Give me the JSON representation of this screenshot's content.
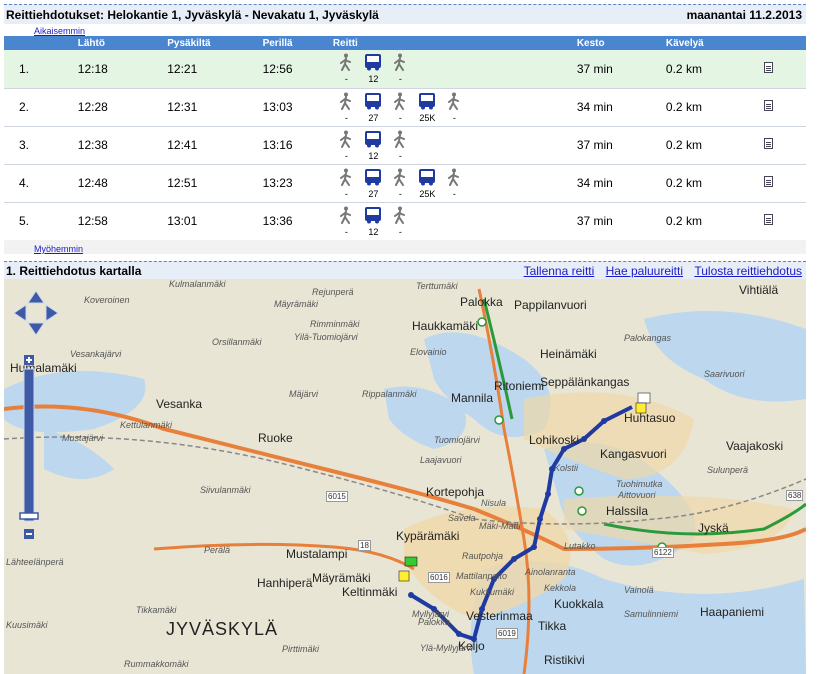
{
  "header": {
    "title": "Reittiehdotukset: Helokantie 1, Jyväskylä - Nevakatu 1, Jyväskylä",
    "date": "maanantai 11.2.2013"
  },
  "nav": {
    "earlier": "Aikaisemmin",
    "later": "Myöhemmin"
  },
  "table": {
    "columns": [
      "Lähtö",
      "Pysäkiltä",
      "Perillä",
      "Reitti",
      "Kesto",
      "Kävelyä"
    ],
    "rows": [
      {
        "no": "1.",
        "dep": "12:18",
        "stop": "12:21",
        "arr": "12:56",
        "legs": [
          {
            "mode": "walk",
            "label": "-"
          },
          {
            "mode": "bus",
            "label": "12"
          },
          {
            "mode": "walk",
            "label": "-"
          }
        ],
        "duration": "37 min",
        "walk": "0.2 km"
      },
      {
        "no": "2.",
        "dep": "12:28",
        "stop": "12:31",
        "arr": "13:03",
        "legs": [
          {
            "mode": "walk",
            "label": "-"
          },
          {
            "mode": "bus",
            "label": "27"
          },
          {
            "mode": "walk",
            "label": "-"
          },
          {
            "mode": "bus",
            "label": "25K"
          },
          {
            "mode": "walk",
            "label": "-"
          }
        ],
        "duration": "34 min",
        "walk": "0.2 km"
      },
      {
        "no": "3.",
        "dep": "12:38",
        "stop": "12:41",
        "arr": "13:16",
        "legs": [
          {
            "mode": "walk",
            "label": "-"
          },
          {
            "mode": "bus",
            "label": "12"
          },
          {
            "mode": "walk",
            "label": "-"
          }
        ],
        "duration": "37 min",
        "walk": "0.2 km"
      },
      {
        "no": "4.",
        "dep": "12:48",
        "stop": "12:51",
        "arr": "13:23",
        "legs": [
          {
            "mode": "walk",
            "label": "-"
          },
          {
            "mode": "bus",
            "label": "27"
          },
          {
            "mode": "walk",
            "label": "-"
          },
          {
            "mode": "bus",
            "label": "25K"
          },
          {
            "mode": "walk",
            "label": "-"
          }
        ],
        "duration": "34 min",
        "walk": "0.2 km"
      },
      {
        "no": "5.",
        "dep": "12:58",
        "stop": "13:01",
        "arr": "13:36",
        "legs": [
          {
            "mode": "walk",
            "label": "-"
          },
          {
            "mode": "bus",
            "label": "12"
          },
          {
            "mode": "walk",
            "label": "-"
          }
        ],
        "duration": "37 min",
        "walk": "0.2 km"
      }
    ]
  },
  "map_section": {
    "title": "1. Reittiehdotus kartalla",
    "links": [
      "Tallenna reitti",
      "Hae paluureitti",
      "Tulosta reittiehdotus"
    ]
  },
  "map": {
    "places": [
      {
        "name": "Terttumäki",
        "cls": "small"
      },
      {
        "name": "Palokka",
        "cls": "med"
      },
      {
        "name": "Pappilanvuori",
        "cls": "med"
      },
      {
        "name": "Vihtiälä",
        "cls": "med"
      },
      {
        "name": "Koveroinen",
        "cls": "small"
      },
      {
        "name": "Kulmalanmäki",
        "cls": "small"
      },
      {
        "name": "Rejunperä",
        "cls": "small"
      },
      {
        "name": "Mäyrämäki",
        "cls": "small"
      },
      {
        "name": "Haukkamäki",
        "cls": "med"
      },
      {
        "name": "Rimminmäki",
        "cls": "small"
      },
      {
        "name": "Yilä-Tuomiojärvi",
        "cls": "small"
      },
      {
        "name": "Orsillanmäki",
        "cls": "small"
      },
      {
        "name": "Elovainio",
        "cls": "small"
      },
      {
        "name": "Heinämäki",
        "cls": "med"
      },
      {
        "name": "Palokangas",
        "cls": "small"
      },
      {
        "name": "Humalamäki",
        "cls": "med"
      },
      {
        "name": "Vesankajärvi",
        "cls": "small"
      },
      {
        "name": "Ritoniemi",
        "cls": "med"
      },
      {
        "name": "Seppälänkangas",
        "cls": "med"
      },
      {
        "name": "Saarivuori",
        "cls": "small"
      },
      {
        "name": "Vesanka",
        "cls": "med"
      },
      {
        "name": "Mäjärvi",
        "cls": "small"
      },
      {
        "name": "Rippalanmäki",
        "cls": "small"
      },
      {
        "name": "Mannila",
        "cls": "med"
      },
      {
        "name": "Huhtasuo",
        "cls": "med"
      },
      {
        "name": "Kettulanmäki",
        "cls": "small"
      },
      {
        "name": "Ruoke",
        "cls": "med"
      },
      {
        "name": "Tuomiojärvi",
        "cls": "small"
      },
      {
        "name": "Lohikoski",
        "cls": "med"
      },
      {
        "name": "Kangasvuori",
        "cls": "med"
      },
      {
        "name": "Mustajärvi",
        "cls": "small"
      },
      {
        "name": "Laajavuori",
        "cls": "small"
      },
      {
        "name": "Sulunperä",
        "cls": "small"
      },
      {
        "name": "Vaajakoski",
        "cls": "med"
      },
      {
        "name": "Siivulanmäki",
        "cls": "small"
      },
      {
        "name": "Kortepohja",
        "cls": "med"
      },
      {
        "name": "Nisula",
        "cls": "small"
      },
      {
        "name": "Halssila",
        "cls": "med"
      },
      {
        "name": "Jyskä",
        "cls": "med"
      },
      {
        "name": "Kypärämäki",
        "cls": "med"
      },
      {
        "name": "Savela",
        "cls": "small"
      },
      {
        "name": "Mäki-Matti",
        "cls": "small"
      },
      {
        "name": "Lutakko",
        "cls": "small"
      },
      {
        "name": "Perälä",
        "cls": "small"
      },
      {
        "name": "Mustalampi",
        "cls": "med"
      },
      {
        "name": "Rautpohja",
        "cls": "small"
      },
      {
        "name": "Lähteelänperä",
        "cls": "small"
      },
      {
        "name": "Hanhiperä",
        "cls": "med"
      },
      {
        "name": "Mäyrämäki",
        "cls": "med"
      },
      {
        "name": "Mattilanpelto",
        "cls": "small"
      },
      {
        "name": "Ainolanranta",
        "cls": "small"
      },
      {
        "name": "Keltinmäki",
        "cls": "med"
      },
      {
        "name": "Kukkumäki",
        "cls": "small"
      },
      {
        "name": "Kekkola",
        "cls": "small"
      },
      {
        "name": "Tikkamäki",
        "cls": "small"
      },
      {
        "name": "Kuokkala",
        "cls": "med"
      },
      {
        "name": "Haapaniemi",
        "cls": "med"
      },
      {
        "name": "Kuusimäki",
        "cls": "small"
      },
      {
        "name": "Myllyjärvi",
        "cls": "small"
      },
      {
        "name": "Palokka",
        "cls": "small"
      },
      {
        "name": "Vesterinmaa",
        "cls": "med"
      },
      {
        "name": "Tikka",
        "cls": "med"
      },
      {
        "name": "Samulinniemi",
        "cls": "small"
      },
      {
        "name": "JYVÄSKYLÄ",
        "cls": "big"
      },
      {
        "name": "Keljo",
        "cls": "med"
      },
      {
        "name": "Ylä-Myllyjärvi",
        "cls": "small"
      },
      {
        "name": "Ristikivi",
        "cls": "med"
      },
      {
        "name": "Rummakkomäki",
        "cls": "small"
      },
      {
        "name": "Pirttimäki",
        "cls": "small"
      },
      {
        "name": "Tuohimutka",
        "cls": "small"
      },
      {
        "name": "Aittovuori",
        "cls": "small"
      },
      {
        "name": "Vainolä",
        "cls": "small"
      },
      {
        "name": "Kolstii",
        "cls": "small"
      }
    ],
    "roads": [
      "6015",
      "18",
      "6016",
      "6019",
      "6122",
      "638"
    ]
  }
}
